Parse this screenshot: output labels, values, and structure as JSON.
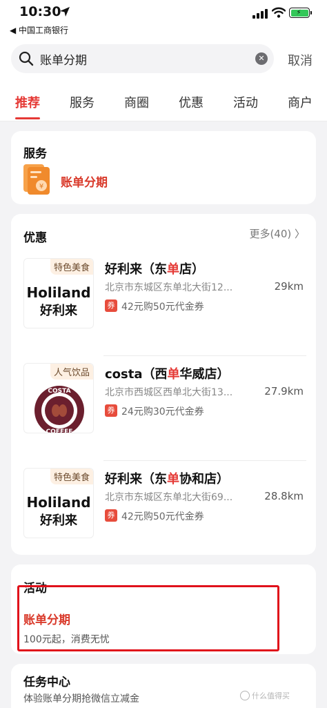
{
  "status_bar": {
    "time": "10:30",
    "back_app": "◀ 中国工商银行"
  },
  "search": {
    "query": "账单分期",
    "cancel_label": "取消"
  },
  "tabs": [
    {
      "label": "推荐"
    },
    {
      "label": "服务"
    },
    {
      "label": "商圈"
    },
    {
      "label": "优惠"
    },
    {
      "label": "活动"
    },
    {
      "label": "商户"
    }
  ],
  "service_card": {
    "title": "服务",
    "item_label": "账单分期",
    "icon": "bill-document-icon"
  },
  "coupon_card": {
    "title": "优惠",
    "more_label": "更多(40) 〉",
    "shops": [
      {
        "tag": "特色美食",
        "logo_text_en": "Holiland",
        "logo_text_cn": "好利来",
        "name_pre": "好利来（东",
        "name_hl": "单",
        "name_post": "店）",
        "address": "北京市东城区东单北大街12...",
        "distance": "29km",
        "badge": "券",
        "deal": "42元购50元代金券"
      },
      {
        "tag": "人气饮品",
        "logo_icon": "costa-coffee-logo",
        "name_pre": "costa（西",
        "name_hl": "单",
        "name_post": "华威店）",
        "address": "北京市西城区西单北大街13...",
        "distance": "27.9km",
        "badge": "券",
        "deal": "24元购30元代金券"
      },
      {
        "tag": "特色美食",
        "logo_text_en": "Holiland",
        "logo_text_cn": "好利来",
        "name_pre": "好利来（东",
        "name_hl": "单",
        "name_post": "协和店）",
        "address": "北京市东城区东单北大街69...",
        "distance": "28.8km",
        "badge": "券",
        "deal": "42元购50元代金券"
      }
    ]
  },
  "activity_card": {
    "title": "活动",
    "name": "账单分期",
    "desc": "100元起，消费无忧"
  },
  "task_card": {
    "title": "任务中心",
    "desc": "体验账单分期抢微信立减金"
  },
  "watermark": "什么值得买",
  "colors": {
    "accent_red": "#e53935",
    "highlight_frame": "#e0101a"
  }
}
